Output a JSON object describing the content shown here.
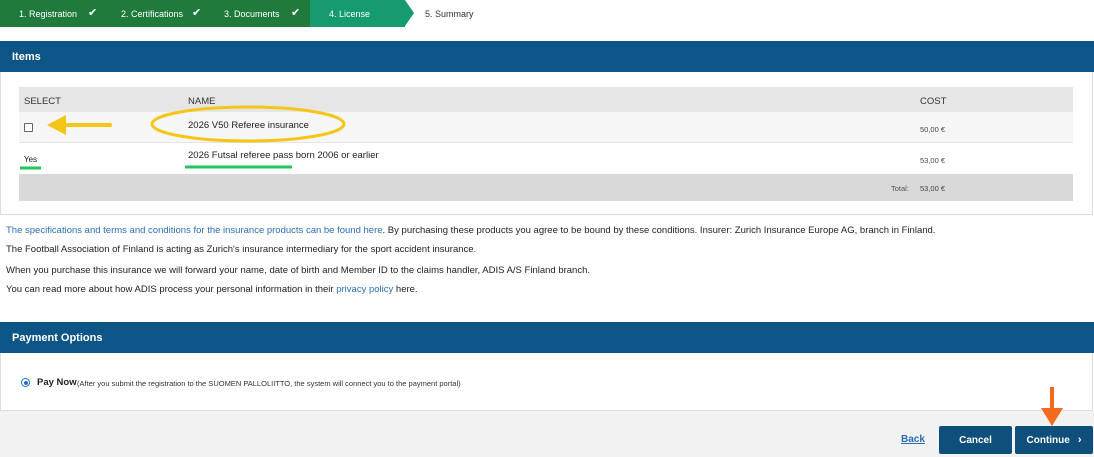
{
  "steps": [
    {
      "label": "1. Registration",
      "status": "done"
    },
    {
      "label": "2. Certifications",
      "status": "done"
    },
    {
      "label": "3. Documents",
      "status": "done"
    },
    {
      "label": "4. License",
      "status": "current"
    },
    {
      "label": "5. Summary",
      "status": "todo"
    }
  ],
  "items": {
    "header": "Items",
    "columns": {
      "select": "SELECT",
      "name": "NAME",
      "cost": "COST"
    },
    "rows": [
      {
        "selected": "",
        "name": "2026 V50 Referee insurance",
        "cost": "50,00 €"
      },
      {
        "selected": "Yes",
        "name": "2026 Futsal referee pass born 2006 or earlier",
        "cost": "53,00 €"
      }
    ],
    "total_label": "Total:",
    "total_value": "53,00 €"
  },
  "info": {
    "line1_link": "The specifications and terms and conditions for the insurance products can be found here",
    "line1_rest": ". By purchasing these products you agree to be bound by these conditions. Insurer: Zurich Insurance Europe AG, branch in Finland.",
    "line2": "The Football Association of Finland is acting as Zurich's insurance intermediary for the sport accident insurance.",
    "line3": "When you purchase this insurance we will forward your name, date of birth and Member ID to the claims handler, ADIS A/S Finland branch.",
    "line4_pre": "You can read more about how ADIS process your personal information in their ",
    "line4_link": "privacy policy",
    "line4_post": " here."
  },
  "payment": {
    "header": "Payment Options",
    "option_label": "Pay Now",
    "option_desc": "(After you submit the registration to the SUOMEN PALLOLIITTO, the system will connect you to the payment portal)"
  },
  "footer": {
    "back": "Back",
    "cancel": "Cancel",
    "continue": "Continue"
  },
  "colors": {
    "step_done": "#1f7a3c",
    "step_current": "#159b6f",
    "header_blue": "#0e5587",
    "annotation_yellow": "#f5c518",
    "annotation_green": "#22c55e",
    "annotation_orange": "#f26b1d"
  }
}
